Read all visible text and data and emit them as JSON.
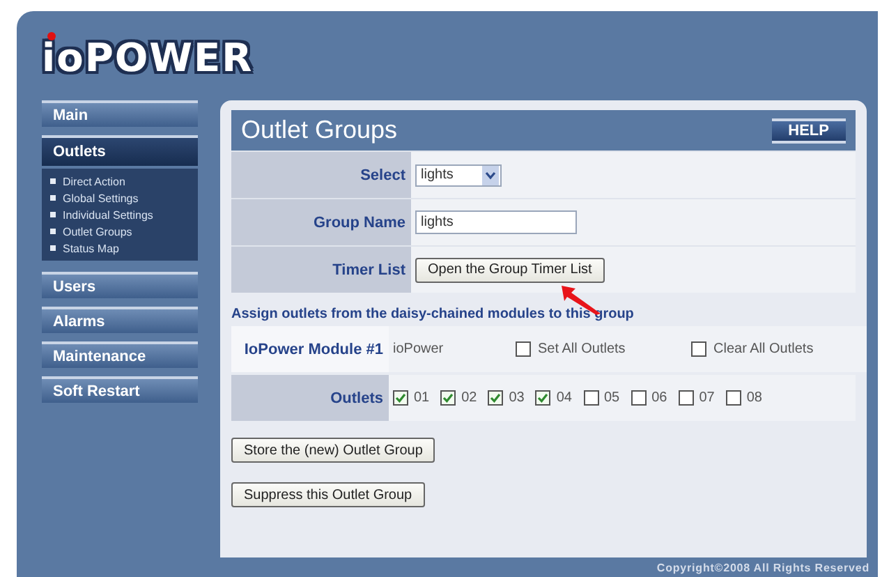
{
  "logo": {
    "text": "ioPOWER"
  },
  "sidebar": {
    "items": [
      {
        "label": "Main",
        "selected": false
      },
      {
        "label": "Outlets",
        "selected": true,
        "children": [
          {
            "label": "Direct Action"
          },
          {
            "label": "Global Settings"
          },
          {
            "label": "Individual Settings"
          },
          {
            "label": "Outlet Groups"
          },
          {
            "label": "Status Map"
          }
        ]
      },
      {
        "label": "Users",
        "selected": false
      },
      {
        "label": "Alarms",
        "selected": false
      },
      {
        "label": "Maintenance",
        "selected": false
      },
      {
        "label": "Soft Restart",
        "selected": false
      }
    ]
  },
  "panel": {
    "title": "Outlet Groups",
    "help_button": "HELP",
    "form": [
      {
        "kind": "select",
        "label": "Select",
        "value": "lights"
      },
      {
        "kind": "text",
        "label": "Group Name",
        "value": "lights"
      },
      {
        "kind": "button",
        "label": "Timer List",
        "value": "Open the Group Timer List"
      }
    ],
    "assign_heading": "Assign outlets from the daisy-chained modules to this group",
    "module": {
      "label": "IoPower Module #1",
      "name": "ioPower",
      "options": [
        {
          "label": "Set All Outlets",
          "checked": false
        },
        {
          "label": "Clear All Outlets",
          "checked": false
        }
      ]
    },
    "outlets": {
      "label": "Outlets",
      "items": [
        {
          "label": "01",
          "checked": true
        },
        {
          "label": "02",
          "checked": true
        },
        {
          "label": "03",
          "checked": true
        },
        {
          "label": "04",
          "checked": true
        },
        {
          "label": "05",
          "checked": false
        },
        {
          "label": "06",
          "checked": false
        },
        {
          "label": "07",
          "checked": false
        },
        {
          "label": "08",
          "checked": false
        }
      ]
    },
    "buttons": [
      "Store the (new) Outlet Group",
      "Suppress this Outlet Group"
    ]
  },
  "footer": "Copyright©2008 All Rights Reserved"
}
